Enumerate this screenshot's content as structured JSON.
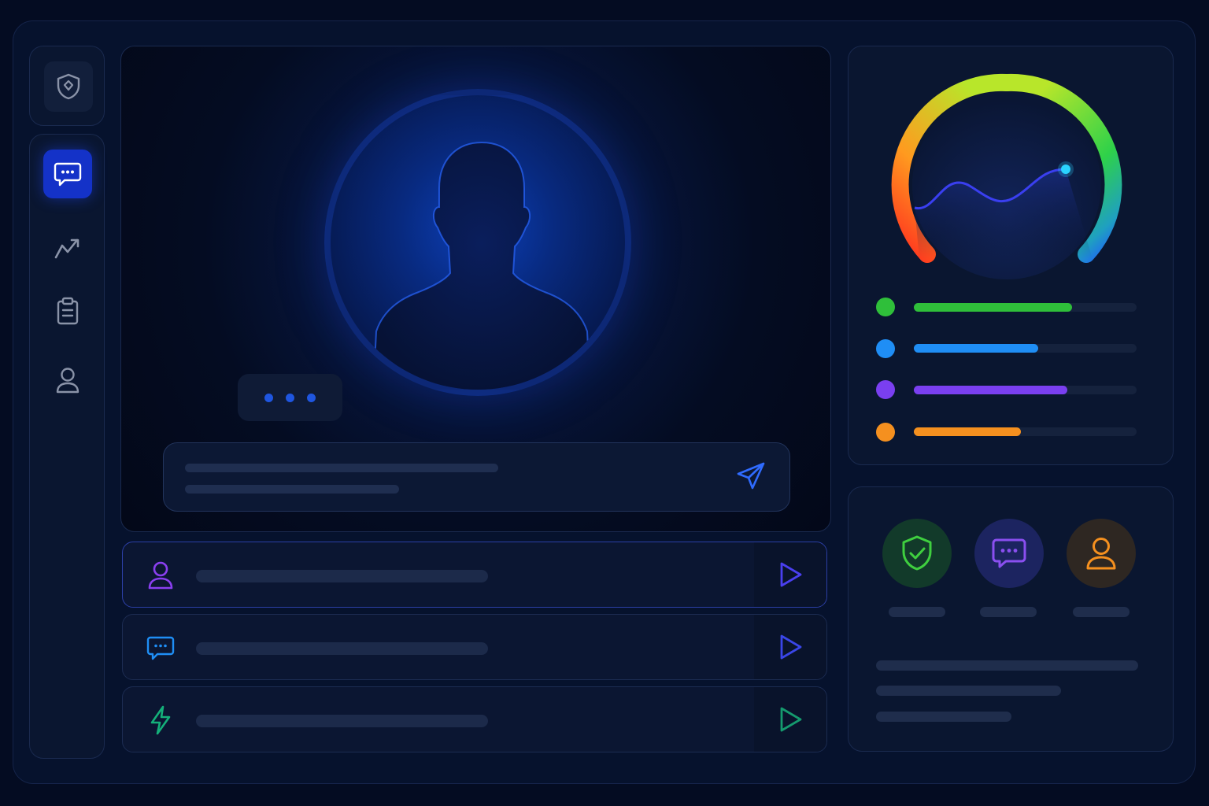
{
  "sidebar": {
    "logo_icon": "shield-icon",
    "nav": [
      {
        "icon": "chat-icon",
        "active": true
      },
      {
        "icon": "trend-icon",
        "active": false
      },
      {
        "icon": "clipboard-icon",
        "active": false
      },
      {
        "icon": "user-icon",
        "active": false
      }
    ]
  },
  "video": {
    "avatar_icon": "person-silhouette-icon",
    "typing_indicator": "typing-dots",
    "composer": {
      "send_icon": "send-icon"
    }
  },
  "list": [
    {
      "icon": "user-icon",
      "color": "#8a3ff0",
      "action_icon": "play-icon",
      "action_color": "#4a3ff0"
    },
    {
      "icon": "chat-icon",
      "color": "#1f8ef5",
      "action_icon": "play-icon",
      "action_color": "#3a46e8"
    },
    {
      "icon": "bolt-icon",
      "color": "#14b07a",
      "action_icon": "play-icon",
      "action_color": "#159a6e"
    }
  ],
  "gauge": {
    "colors": [
      "#ff3b1f",
      "#ff9a1f",
      "#b8e62a",
      "#2ed14a",
      "#1f6bff"
    ],
    "stats": [
      {
        "color": "#2fbf3a",
        "value": 0.71
      },
      {
        "color": "#1f8ef5",
        "value": 0.56
      },
      {
        "color": "#7a3ff0",
        "value": 0.69
      },
      {
        "color": "#f5901f",
        "value": 0.48
      }
    ]
  },
  "quick_actions": [
    {
      "icon": "shield-check-icon",
      "color": "#3fcf3f",
      "bg": "#123a2a"
    },
    {
      "icon": "chat-icon",
      "color": "#8a4ff0",
      "bg": "#1c2460"
    },
    {
      "icon": "user-icon",
      "color": "#f5901f",
      "bg": "#2e2722"
    }
  ]
}
